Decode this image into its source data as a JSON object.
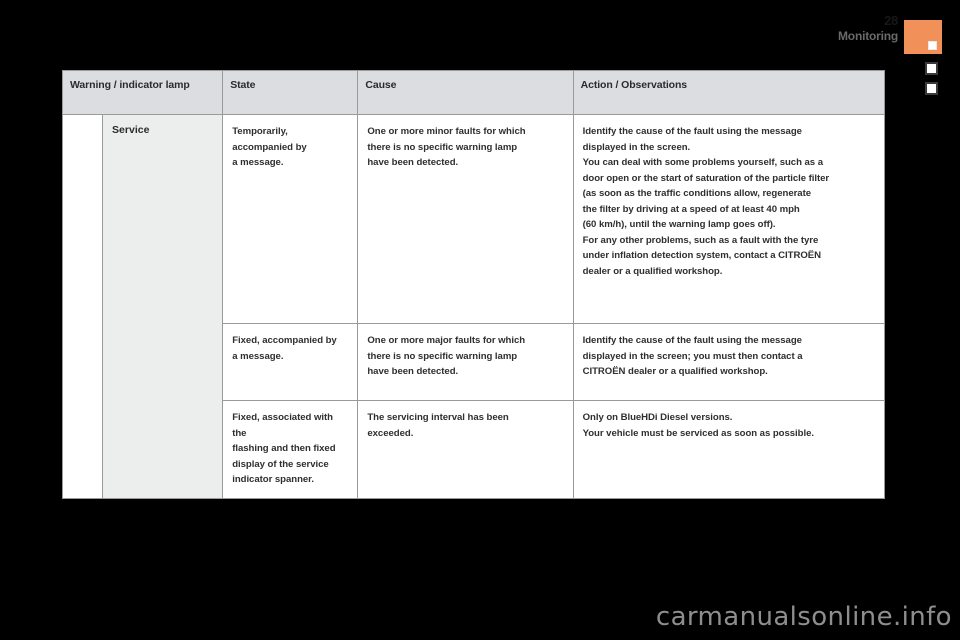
{
  "page": {
    "number": "28",
    "section_title": "Monitoring",
    "watermark": "carmanualsonline.info",
    "accent_color": "#f2904f",
    "tab_color": "#f2905a",
    "header_bg": "#dcdde0",
    "name_cell_bg": "#eceded"
  },
  "table": {
    "headers": [
      "Warning / indicator lamp",
      "State",
      "Cause",
      "Action / Observations"
    ],
    "lamp_name": "Service",
    "rows": [
      {
        "state_lines": [
          "Temporarily,",
          "accompanied by",
          "a message."
        ],
        "cause_lines": [
          "One or more minor faults for which",
          "there is no specific warning lamp",
          "have been detected."
        ],
        "action_lines": [
          "Identify the cause of the fault using the message",
          "displayed in the screen.",
          "You can deal with some problems yourself, such as a",
          "door open or the start of saturation of the particle filter",
          "(as soon as the traffic conditions allow, regenerate",
          "the filter by driving at a speed of at least 40 mph",
          "(60 km/h), until the warning lamp goes off).",
          "For any other problems, such as a fault with the tyre",
          "under inflation detection system, contact a CITROËN",
          "dealer or a qualified workshop."
        ]
      },
      {
        "state_lines": [
          "Fixed, accompanied by",
          "a message."
        ],
        "cause_lines": [
          "One or more major faults for which",
          "there is no specific warning lamp",
          "have been detected."
        ],
        "action_lines": [
          "Identify the cause of the fault using the message",
          "displayed in the screen; you must then contact a",
          "CITROËN dealer or a qualified workshop."
        ]
      },
      {
        "state_lines": [
          "Fixed, associated with the",
          "flashing and then fixed",
          "display of the service",
          "indicator spanner."
        ],
        "cause_lines": [
          "The servicing interval has been",
          "exceeded."
        ],
        "action_lines": [
          "Only on BlueHDi Diesel versions.",
          "Your vehicle must be serviced as soon as possible."
        ]
      }
    ]
  }
}
